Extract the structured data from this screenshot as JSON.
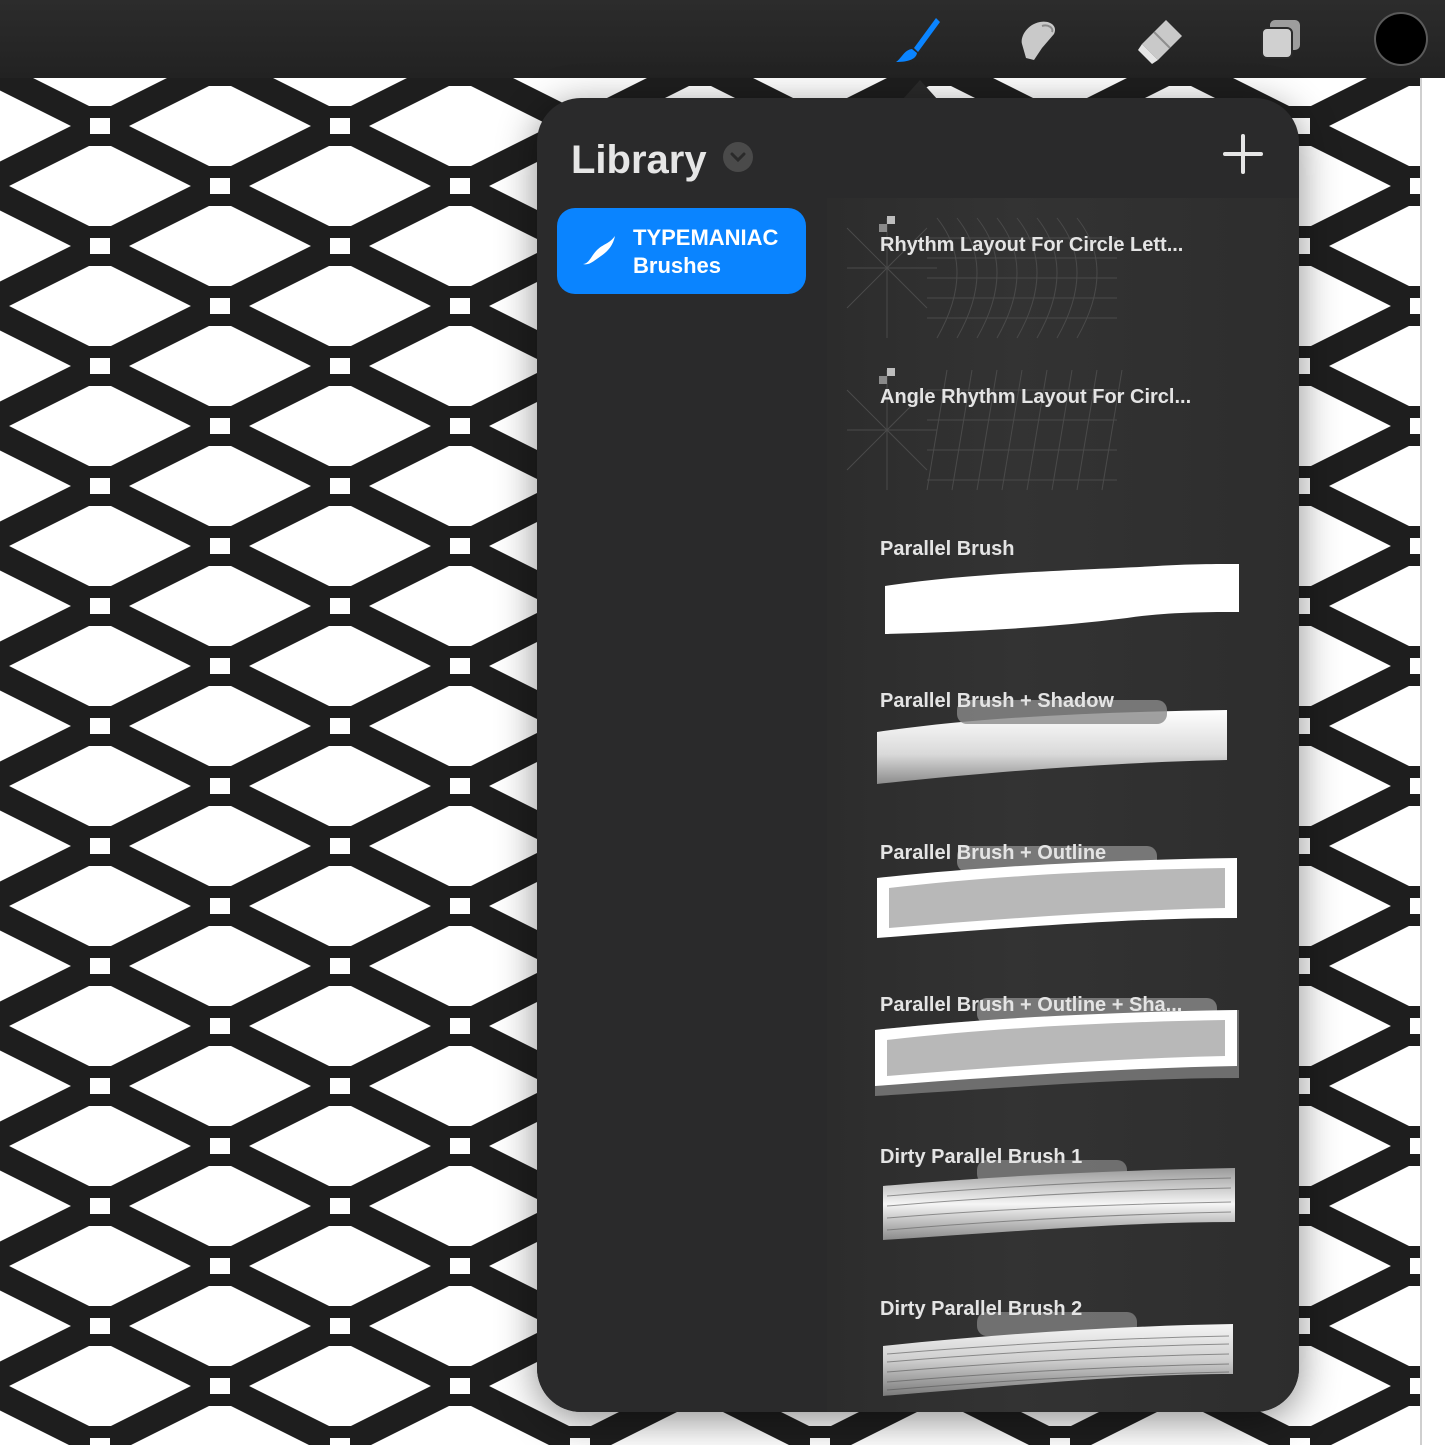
{
  "toolbar": {
    "tools": [
      {
        "name": "brush-tool",
        "icon": "paintbrush-icon",
        "active": true
      },
      {
        "name": "smudge-tool",
        "icon": "smudge-finger-icon",
        "active": false
      },
      {
        "name": "eraser-tool",
        "icon": "eraser-icon",
        "active": false
      },
      {
        "name": "layers-tool",
        "icon": "layers-icon",
        "active": false
      }
    ],
    "current_color": "#000000",
    "active_color": "#0a84ff"
  },
  "library": {
    "title": "Library",
    "sets": [
      {
        "label_line1": "TYPEMANIAC",
        "label_line2": "Brushes",
        "icon": "brush-set-icon",
        "selected": true
      }
    ],
    "brushes": [
      {
        "name": "Rhythm Layout For Circle Lett..."
      },
      {
        "name": "Angle Rhythm Layout For Circl..."
      },
      {
        "name": "Parallel Brush"
      },
      {
        "name": "Parallel Brush + Shadow"
      },
      {
        "name": "Parallel Brush + Outline"
      },
      {
        "name": "Parallel Brush + Outline + Sha..."
      },
      {
        "name": "Dirty Parallel Brush 1"
      },
      {
        "name": "Dirty Parallel Brush 2"
      }
    ]
  }
}
